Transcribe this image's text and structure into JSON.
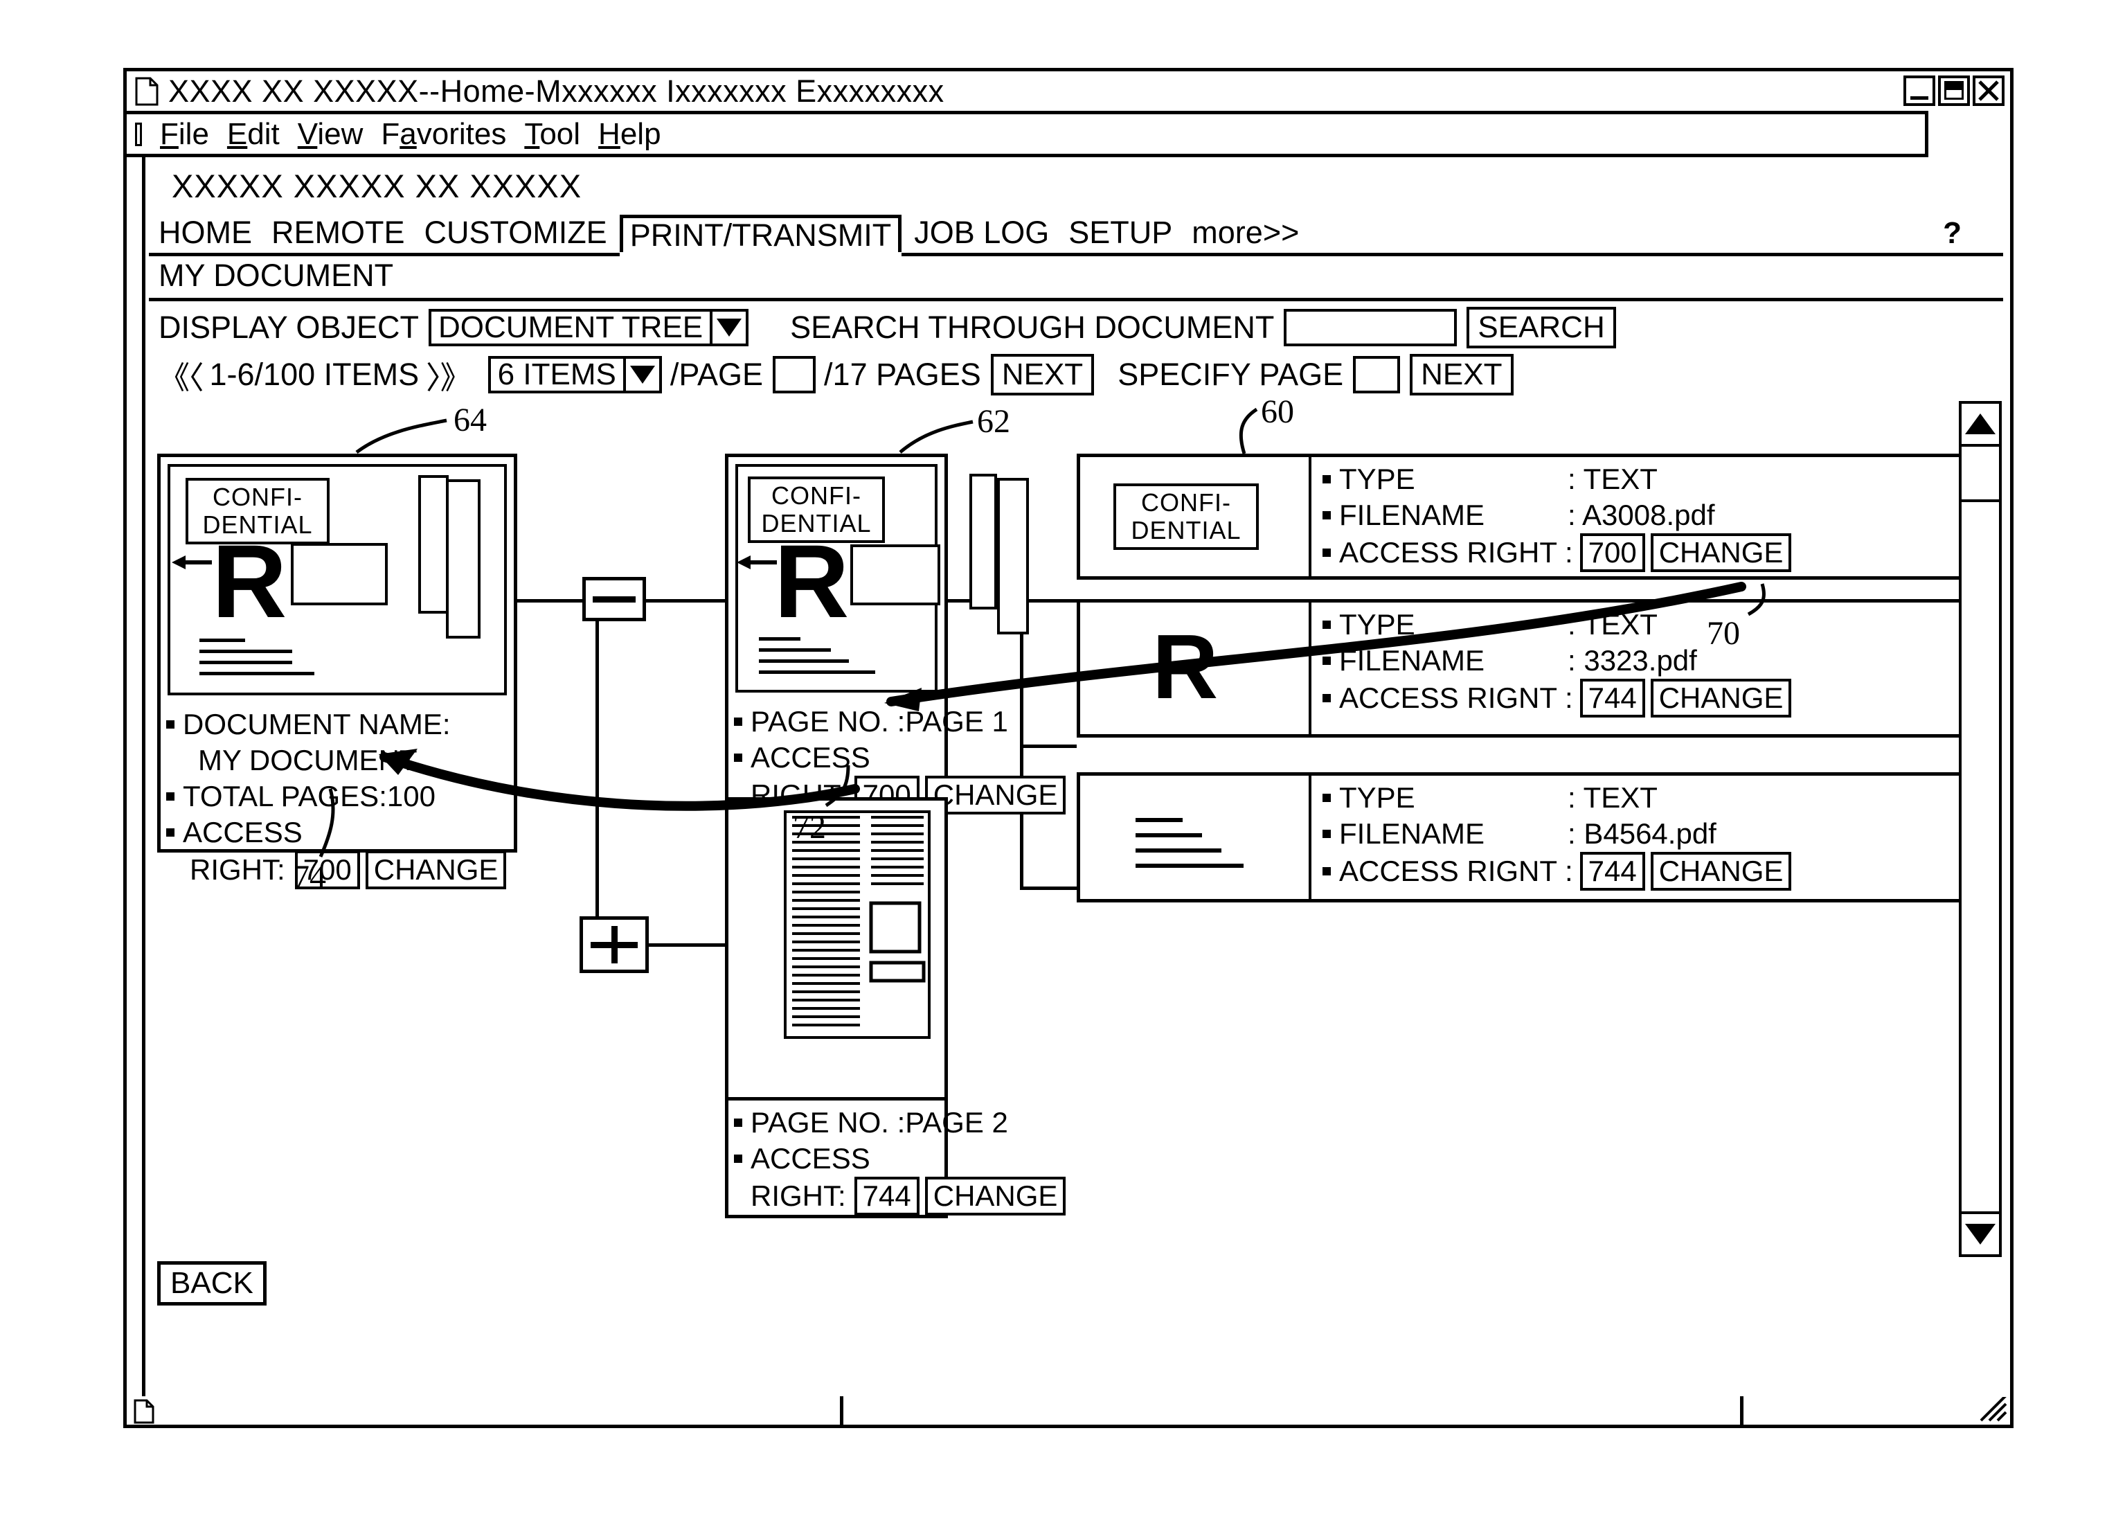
{
  "window": {
    "title": "XXXX XX XXXXX--Home-Mxxxxxx Ixxxxxxx Exxxxxxxx",
    "doc_icon": "document-icon",
    "controls": {
      "minimize": "minimize-icon",
      "maximize": "maximize-icon",
      "close": "close-icon"
    }
  },
  "menubar": {
    "items": [
      {
        "label": "File",
        "accel": "F"
      },
      {
        "label": "Edit",
        "accel": "E"
      },
      {
        "label": "View",
        "accel": "V"
      },
      {
        "label": "Favorites",
        "accel": "a"
      },
      {
        "label": "Tool",
        "accel": "T"
      },
      {
        "label": "Help",
        "accel": "H"
      }
    ]
  },
  "app": {
    "title": "XXXXX   XXXXX XX XXXXX",
    "help_label": "?"
  },
  "tabs": [
    {
      "label": "HOME",
      "active": false
    },
    {
      "label": "REMOTE",
      "active": false
    },
    {
      "label": "CUSTOMIZE",
      "active": false
    },
    {
      "label": "PRINT/TRANSMIT",
      "active": true
    },
    {
      "label": "JOB LOG",
      "active": false
    },
    {
      "label": "SETUP",
      "active": false
    },
    {
      "label": "more>>",
      "active": false
    }
  ],
  "breadcrumb": "MY DOCUMENT",
  "toolbar": {
    "display_object_label": "DISPLAY OBJECT",
    "display_object_value": "DOCUMENT TREE",
    "search_label": "SEARCH THROUGH DOCUMENT",
    "search_value": "",
    "search_button": "SEARCH"
  },
  "pager": {
    "first_arrows": "《〈",
    "range": "1-6/100 ITEMS",
    "last_arrows": "〉》",
    "items_per_page": "6 ITEMS",
    "per_page_label": "/PAGE",
    "page_value": "",
    "pages_total_label": "/17 PAGES",
    "next_button": "NEXT",
    "specify_page_label": "SPECIFY PAGE",
    "specify_page_value": "",
    "specify_next_button": "NEXT"
  },
  "callouts": {
    "doc_node": "64",
    "page_node": "62",
    "file_node": "60",
    "file_access": "70",
    "page_access": "72",
    "doc_access": "74"
  },
  "document_node": {
    "confidential_line1": "CONFI-",
    "confidential_line2": "DENTIAL",
    "preview_letter": "R",
    "fields": [
      {
        "key": "DOCUMENT NAME:",
        "value": "MY DOCUMENT"
      },
      {
        "key": "TOTAL PAGES:100",
        "value": ""
      }
    ],
    "access_label_1": "ACCESS",
    "access_label_2": "RIGHT:",
    "access_value": "700",
    "change_button": "CHANGE"
  },
  "page_nodes": [
    {
      "confidential_line1": "CONFI-",
      "confidential_line2": "DENTIAL",
      "preview_letter": "R",
      "page_no_label": "PAGE NO. :PAGE 1",
      "access_label_1": "ACCESS",
      "access_label_2": "RIGHT:",
      "access_value": "700",
      "change_button": "CHANGE"
    },
    {
      "page_no_label": "PAGE NO. :PAGE 2",
      "access_label_1": "ACCESS",
      "access_label_2": "RIGHT:",
      "access_value": "744",
      "change_button": "CHANGE"
    }
  ],
  "file_nodes": [
    {
      "icon": "confidential-badge",
      "confidential_line1": "CONFI-",
      "confidential_line2": "DENTIAL",
      "type_key": "TYPE",
      "type_value": ": TEXT",
      "filename_key": "FILENAME",
      "filename_value": ": A3008.pdf",
      "access_key": "ACCESS RIGHT :",
      "access_value": "700",
      "change_button": "CHANGE"
    },
    {
      "icon": "letter-r",
      "preview_letter": "R",
      "type_key": "TYPE",
      "type_value": ": TEXT",
      "filename_key": "FILENAME",
      "filename_value": ": 3323.pdf",
      "access_key": "ACCESS RIGNT :",
      "access_value": "744",
      "change_button": "CHANGE"
    },
    {
      "icon": "text-lines",
      "type_key": "TYPE",
      "type_value": ": TEXT",
      "filename_key": "FILENAME",
      "filename_value": ": B4564.pdf",
      "access_key": "ACCESS RIGNT :",
      "access_value": "744",
      "change_button": "CHANGE"
    }
  ],
  "tree_toggles": [
    {
      "state": "minus",
      "name": "collapse-toggle"
    },
    {
      "state": "plus",
      "name": "expand-toggle"
    }
  ],
  "scrollbar": {
    "up_arrow": "scroll-up-icon",
    "down_arrow": "scroll-down-icon"
  },
  "footer": {
    "back_button": "BACK"
  },
  "colors": {
    "ink": "#000000",
    "paper": "#ffffff"
  }
}
